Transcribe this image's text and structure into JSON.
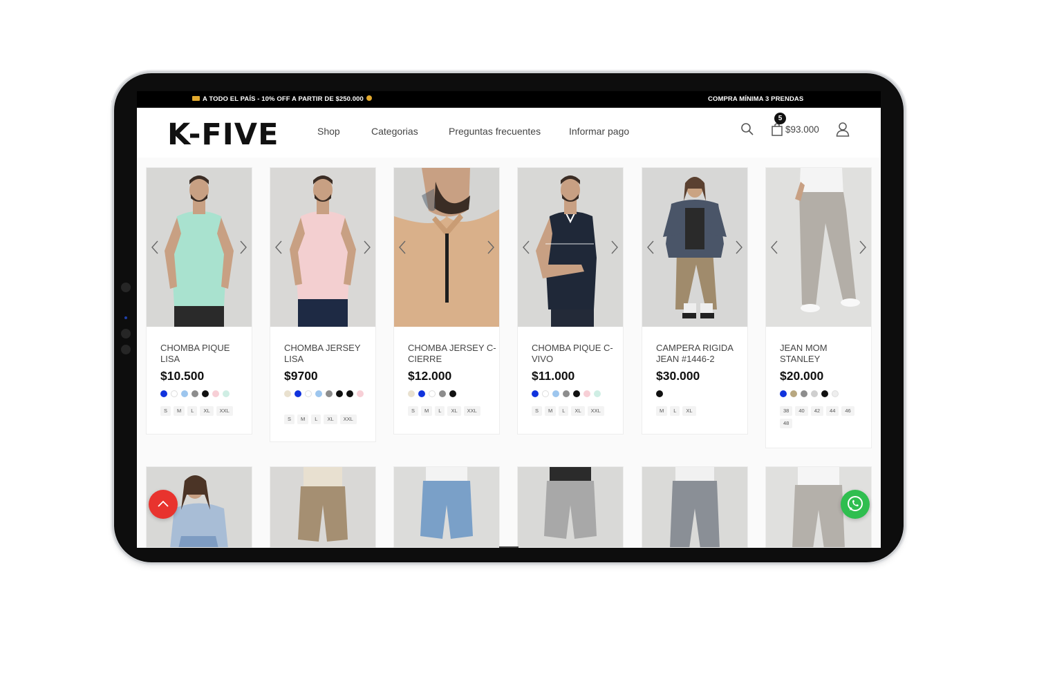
{
  "promo_bar": {
    "left_text": "A TODO EL PAÍS - 10% OFF A PARTIR DE $250.000",
    "right_text": "COMPRA MÍNIMA 3 PRENDAS"
  },
  "header": {
    "logo": "K-FIVE",
    "nav": [
      "Shop",
      "Categorias",
      "Preguntas frecuentes",
      "Informar pago"
    ],
    "cart_count": "5",
    "cart_total": "$93.000"
  },
  "colors": {
    "accent_red": "#e8332e",
    "whatsapp_green": "#2fbe4f",
    "topbar": "#000000"
  },
  "products": [
    {
      "name": "CHOMBA PIQUE LISA",
      "price": "$10.500",
      "swatches": [
        "#1133dd",
        "#ffffff",
        "#9dc6ee",
        "#8d8d8d",
        "#111111",
        "#f7cfd6",
        "#cfeee4"
      ],
      "sizes": [
        "S",
        "M",
        "L",
        "XL",
        "XXL"
      ]
    },
    {
      "name": "CHOMBA JERSEY LISA",
      "price": "$9700",
      "swatches": [
        "#e9e1cf",
        "#1133dd",
        "#ffffff",
        "#9dc6ee",
        "#8d8d8d",
        "#111111",
        "#111111",
        "#f7cfd6"
      ],
      "sizes": [
        "S",
        "M",
        "L",
        "XL",
        "XXL"
      ]
    },
    {
      "name": "CHOMBA JERSEY C-CIERRE",
      "price": "$12.000",
      "swatches": [
        "#e9e1cf",
        "#1133dd",
        "#ffffff",
        "#8d8d8d",
        "#111111"
      ],
      "sizes": [
        "S",
        "M",
        "L",
        "XL",
        "XXL"
      ]
    },
    {
      "name": "CHOMBA PIQUE C-VIVO",
      "price": "$11.000",
      "swatches": [
        "#1133dd",
        "#ffffff",
        "#9dc6ee",
        "#8d8d8d",
        "#111111",
        "#f7cfd6",
        "#cfeee4"
      ],
      "sizes": [
        "S",
        "M",
        "L",
        "XL",
        "XXL"
      ]
    },
    {
      "name": "CAMPERA RIGIDA JEAN #1446-2",
      "price": "$30.000",
      "swatches": [
        "#111111"
      ],
      "sizes": [
        "M",
        "L",
        "XL"
      ]
    },
    {
      "name": "JEAN MOM STANLEY",
      "price": "$20.000",
      "swatches": [
        "#1133dd",
        "#b8a780",
        "#8d8d8d",
        "#cfcfcf",
        "#111111",
        "#eeeeee"
      ],
      "sizes": [
        "38",
        "40",
        "42",
        "44",
        "46",
        "48"
      ]
    }
  ]
}
